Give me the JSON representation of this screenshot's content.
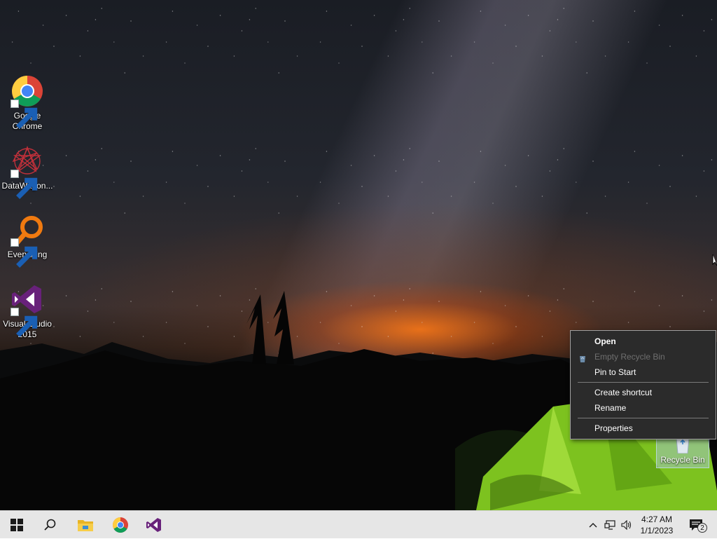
{
  "desktop": {
    "icons": [
      {
        "label": "Google Chrome",
        "icon": "chrome-icon"
      },
      {
        "label": "DataWagon...",
        "icon": "datawagon-icon"
      },
      {
        "label": "Everything",
        "icon": "everything-icon"
      },
      {
        "label": "Visual Studio 2015",
        "icon": "visual-studio-icon"
      }
    ],
    "recycle_bin": {
      "label": "Recycle Bin",
      "icon": "recycle-bin-icon"
    }
  },
  "context_menu": {
    "items": [
      {
        "label": "Open",
        "bold": true,
        "enabled": true
      },
      {
        "label": "Empty Recycle Bin",
        "enabled": false,
        "icon": "recycle-small-icon"
      },
      {
        "label": "Pin to Start",
        "enabled": true
      },
      {
        "label": "Create shortcut",
        "enabled": true
      },
      {
        "label": "Rename",
        "enabled": true
      },
      {
        "label": "Properties",
        "enabled": true
      }
    ]
  },
  "taskbar": {
    "buttons": [
      "windows-start-icon",
      "search-icon",
      "file-explorer-icon",
      "chrome-icon",
      "visual-studio-icon"
    ],
    "tray": [
      "chevron-up-icon",
      "network-icon",
      "volume-icon"
    ],
    "clock": {
      "time": "4:27 AM",
      "date": "1/1/2023"
    },
    "notifications": {
      "count": "2",
      "icon": "action-center-icon"
    }
  },
  "colors": {
    "taskbar_bg": "#e6e6e6",
    "menu_bg": "#2b2b2b",
    "vs_purple": "#68217a"
  }
}
